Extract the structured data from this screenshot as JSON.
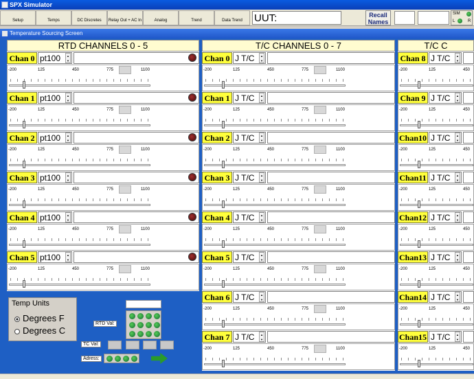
{
  "window": {
    "title": "SPX Simulator"
  },
  "toolbar": {
    "buttons": [
      "Setup",
      "Temps",
      "DC Discretes",
      "Relay Out + AC In",
      "Analog",
      "Trend",
      "Data Trend"
    ],
    "uut_label": "UUT:",
    "recall_line1": "Recall",
    "recall_line2": "Names",
    "sim_label": "SIM",
    "l_label": "L",
    "r_label": "R"
  },
  "screen": {
    "title": "Temperature Sourcing Screen"
  },
  "scale": {
    "ticks": [
      "-200",
      "125",
      "450",
      "775",
      "1100"
    ]
  },
  "rtd": {
    "header": "RTD CHANNELS 0 - 5",
    "channels": [
      {
        "name": "Chan 0",
        "type": "pt100",
        "value": 0.1
      },
      {
        "name": "Chan 1",
        "type": "pt100",
        "value": 0.1
      },
      {
        "name": "Chan 2",
        "type": "pt100",
        "value": 0.1
      },
      {
        "name": "Chan 3",
        "type": "pt100",
        "value": 0.1
      },
      {
        "name": "Chan 4",
        "type": "pt100",
        "value": 0.1
      },
      {
        "name": "Chan 5",
        "type": "pt100",
        "value": 0.1
      }
    ]
  },
  "tc": {
    "header": "T/C CHANNELS 0 - 7",
    "channels": [
      {
        "name": "Chan 0",
        "type": "J T/C",
        "value": 0.13
      },
      {
        "name": "Chan 1",
        "type": "J T/C",
        "value": 0.13
      },
      {
        "name": "Chan 2",
        "type": "J T/C",
        "value": 0.13
      },
      {
        "name": "Chan 3",
        "type": "J T/C",
        "value": 0.13
      },
      {
        "name": "Chan 4",
        "type": "J T/C",
        "value": 0.13
      },
      {
        "name": "Chan 5",
        "type": "J T/C",
        "value": 0.13
      },
      {
        "name": "Chan 6",
        "type": "J T/C",
        "value": 0.13
      },
      {
        "name": "Chan 7",
        "type": "J T/C",
        "value": 0.13
      }
    ]
  },
  "tc2": {
    "header": "T/C C",
    "channels": [
      {
        "name": "Chan 8",
        "type": "J T/C"
      },
      {
        "name": "Chan 9",
        "type": "J T/C"
      },
      {
        "name": "Chan10",
        "type": "J T/C"
      },
      {
        "name": "Chan11",
        "type": "J T/C"
      },
      {
        "name": "Chan12",
        "type": "J T/C"
      },
      {
        "name": "Chan13",
        "type": "J T/C"
      },
      {
        "name": "Chan14",
        "type": "J T/C"
      },
      {
        "name": "Chan15",
        "type": "J T/C"
      }
    ]
  },
  "temp_units": {
    "legend": "Temp Units",
    "options": [
      "Degrees F",
      "Degrees C"
    ],
    "selected": 0
  },
  "panel": {
    "rtd_val_label": "RTD Val:",
    "tc_val_label": "TC Val:",
    "address_label": "Adress:"
  },
  "colors": {
    "background": "#1e5fc4",
    "channel_label": "#ffff3c",
    "header": "#fffcd0",
    "led_off": "#6a1010",
    "led_green": "#2a9a2a"
  }
}
